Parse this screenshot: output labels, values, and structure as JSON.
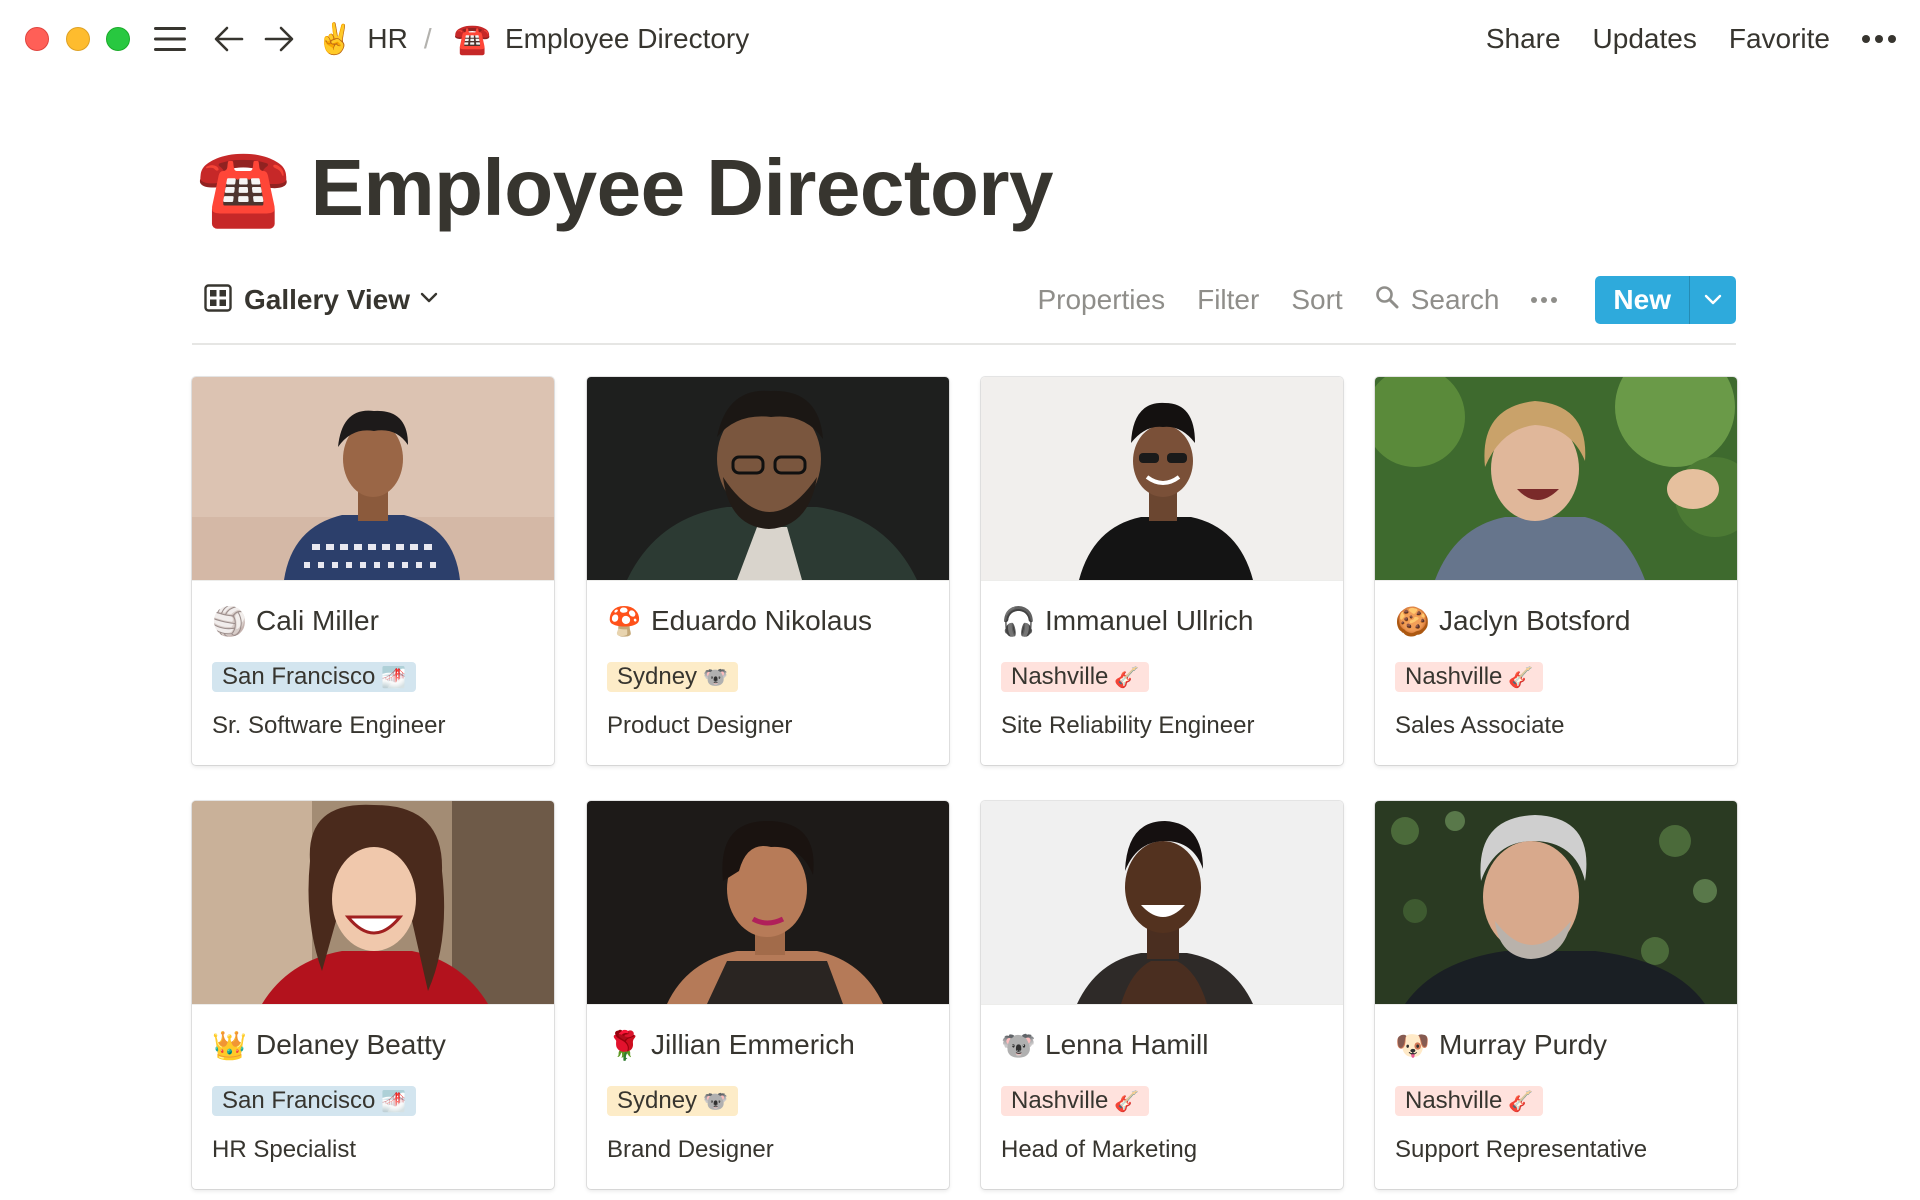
{
  "topbar": {
    "breadcrumbs": [
      {
        "emoji": "✌️",
        "label": "HR"
      },
      {
        "emoji": "☎️",
        "label": "Employee Directory"
      }
    ],
    "separator": "/",
    "actions": {
      "share": "Share",
      "updates": "Updates",
      "favorite": "Favorite"
    }
  },
  "page": {
    "emoji": "☎️",
    "title": "Employee Directory"
  },
  "view": {
    "name": "Gallery View",
    "tools": {
      "properties": "Properties",
      "filter": "Filter",
      "sort": "Sort",
      "search": "Search"
    },
    "new_label": "New"
  },
  "colors": {
    "accent": "#2eaadc",
    "tag_blue": "#d3e5ef",
    "tag_yellow": "#fdecc8",
    "tag_red": "#ffe2dd"
  },
  "employees": [
    {
      "emoji": "🏐",
      "name": "Cali Miller",
      "location": "San Francisco",
      "location_emoji": "🌁",
      "role": "Sr. Software Engineer"
    },
    {
      "emoji": "🍄",
      "name": "Eduardo Nikolaus",
      "location": "Sydney",
      "location_emoji": "🐨",
      "role": "Product Designer"
    },
    {
      "emoji": "🎧",
      "name": "Immanuel Ullrich",
      "location": "Nashville",
      "location_emoji": "🎸",
      "role": "Site Reliability Engineer"
    },
    {
      "emoji": "🍪",
      "name": "Jaclyn Botsford",
      "location": "Nashville",
      "location_emoji": "🎸",
      "role": "Sales Associate"
    },
    {
      "emoji": "👑",
      "name": "Delaney Beatty",
      "location": "San Francisco",
      "location_emoji": "🌁",
      "role": "HR Specialist"
    },
    {
      "emoji": "🌹",
      "name": "Jillian Emmerich",
      "location": "Sydney",
      "location_emoji": "🐨",
      "role": "Brand Designer"
    },
    {
      "emoji": "🐨",
      "name": "Lenna Hamill",
      "location": "Nashville",
      "location_emoji": "🎸",
      "role": "Head of Marketing"
    },
    {
      "emoji": "🐶",
      "name": "Murray Purdy",
      "location": "Nashville",
      "location_emoji": "🎸",
      "role": "Support Representative"
    }
  ]
}
